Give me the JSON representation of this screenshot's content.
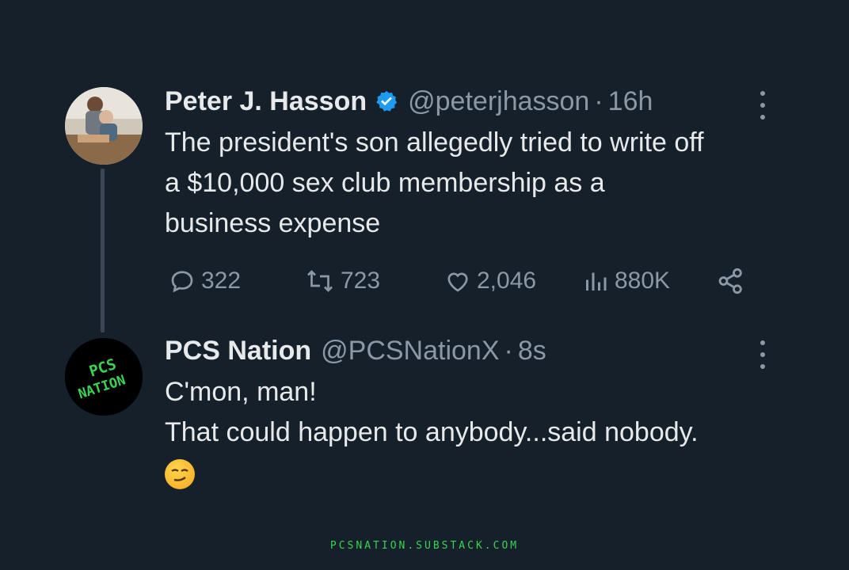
{
  "tweets": [
    {
      "name": "Peter J. Hasson",
      "handle": "@peterjhasson",
      "separator": "·",
      "time": "16h",
      "verified": true,
      "text_lines": [
        "The president's son allegedly tried to write off",
        "a $10,000 sex club membership as a",
        "business expense"
      ],
      "stats": {
        "replies": "322",
        "reposts": "723",
        "likes": "2,046",
        "views": "880K"
      }
    },
    {
      "name": "PCS Nation",
      "handle": "@PCSNationX",
      "separator": "·",
      "time": "8s",
      "avatar_text": "PCS NATION",
      "text_lines": [
        "C'mon, man!",
        "That could happen to anybody...said nobody."
      ],
      "emoji": "smirking-face"
    }
  ],
  "footer": "PCSNATION.SUBSTACK.COM",
  "colors": {
    "background": "#15202b",
    "text": "#e7e9ea",
    "muted": "#8b98a5",
    "verified": "#1d9bf0",
    "footer": "#39d353"
  }
}
